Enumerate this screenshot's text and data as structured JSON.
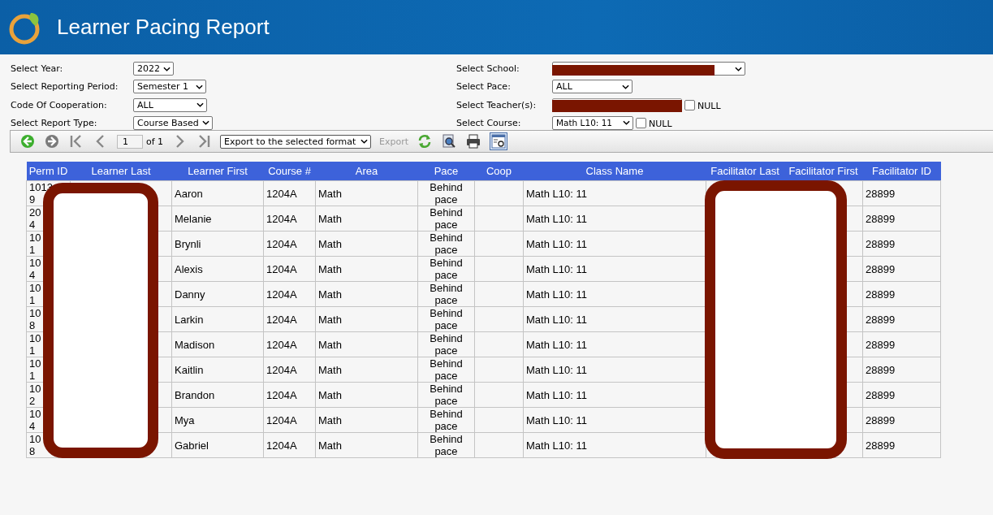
{
  "header": {
    "title": "Learner Pacing Report"
  },
  "filters_left": [
    {
      "label": "Select Year:",
      "value": "2022"
    },
    {
      "label": "Select Reporting Period:",
      "value": "Semester 1"
    },
    {
      "label": "Code Of Cooperation:",
      "value": "ALL"
    },
    {
      "label": "Select Report Type:",
      "value": "Course Based"
    }
  ],
  "filters_right": [
    {
      "label": "Select School:",
      "kind": "select",
      "redacted": true
    },
    {
      "label": "Select Pace:",
      "kind": "select",
      "value": "ALL",
      "redacted": false
    },
    {
      "label": "Select Teacher(s):",
      "kind": "list",
      "redacted": true,
      "null_label": "NULL",
      "null_checked": false
    },
    {
      "label": "Select Course:",
      "kind": "select",
      "value": "Math L10: 11",
      "redacted": false,
      "null_label": "NULL",
      "null_checked": false
    }
  ],
  "toolbar": {
    "page": "1",
    "page_of": "of 1",
    "export_format": "Export to the selected format",
    "export_label": "Export"
  },
  "table": {
    "columns": [
      "Perm ID",
      "Learner Last",
      "Learner First",
      "Course #",
      "Area",
      "Pace",
      "Coop",
      "Class Name",
      "Facilitator Last",
      "Facilitator First",
      "Facilitator ID"
    ],
    "rows": [
      {
        "perm_id": [
          "1013",
          "9"
        ],
        "learner_first": "Aaron",
        "course": "1204A",
        "area": "Math",
        "pace": "Behind pace",
        "class_name": "Math L10: 11",
        "facilitator_id": "28899"
      },
      {
        "perm_id": [
          "20",
          "4"
        ],
        "learner_first": "Melanie",
        "course": "1204A",
        "area": "Math",
        "pace": "Behind pace",
        "class_name": "Math L10: 11",
        "facilitator_id": "28899"
      },
      {
        "perm_id": [
          "10",
          "1"
        ],
        "learner_first": "Brynli",
        "course": "1204A",
        "area": "Math",
        "pace": "Behind pace",
        "class_name": "Math L10: 11",
        "facilitator_id": "28899"
      },
      {
        "perm_id": [
          "10",
          "4"
        ],
        "learner_first": "Alexis",
        "course": "1204A",
        "area": "Math",
        "pace": "Behind pace",
        "class_name": "Math L10: 11",
        "facilitator_id": "28899"
      },
      {
        "perm_id": [
          "10",
          "1"
        ],
        "learner_first": "Danny",
        "course": "1204A",
        "area": "Math",
        "pace": "Behind pace",
        "class_name": "Math L10: 11",
        "facilitator_id": "28899"
      },
      {
        "perm_id": [
          "10",
          "8"
        ],
        "learner_first": "Larkin",
        "course": "1204A",
        "area": "Math",
        "pace": "Behind pace",
        "class_name": "Math L10: 11",
        "facilitator_id": "28899"
      },
      {
        "perm_id": [
          "10",
          "1"
        ],
        "learner_first": "Madison",
        "course": "1204A",
        "area": "Math",
        "pace": "Behind pace",
        "class_name": "Math L10: 11",
        "facilitator_id": "28899"
      },
      {
        "perm_id": [
          "10",
          "1"
        ],
        "learner_first": "Kaitlin",
        "course": "1204A",
        "area": "Math",
        "pace": "Behind pace",
        "class_name": "Math L10: 11",
        "facilitator_id": "28899"
      },
      {
        "perm_id": [
          "10",
          "2"
        ],
        "learner_first": "Brandon",
        "course": "1204A",
        "area": "Math",
        "pace": "Behind pace",
        "class_name": "Math L10: 11",
        "facilitator_id": "28899"
      },
      {
        "perm_id": [
          "10",
          "4"
        ],
        "learner_first": "Mya",
        "course": "1204A",
        "area": "Math",
        "pace": "Behind pace",
        "class_name": "Math L10: 11",
        "facilitator_id": "28899"
      },
      {
        "perm_id": [
          "10",
          "8"
        ],
        "learner_first": "Gabriel",
        "course": "1204A",
        "area": "Math",
        "pace": "Behind pace",
        "class_name": "Math L10: 11",
        "facilitator_id": "28899"
      }
    ]
  }
}
